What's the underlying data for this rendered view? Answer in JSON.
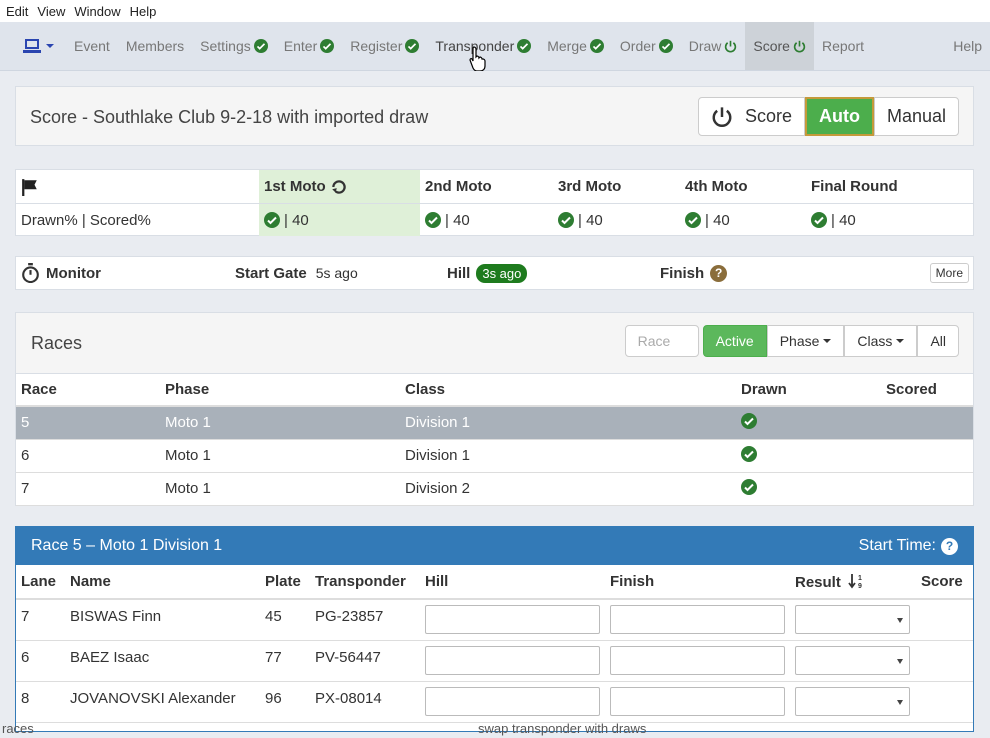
{
  "menu": [
    "Edit",
    "View",
    "Window",
    "Help"
  ],
  "nav": {
    "items": [
      {
        "label": "Event",
        "status": ""
      },
      {
        "label": "Members",
        "status": ""
      },
      {
        "label": "Settings",
        "status": "check"
      },
      {
        "label": "Enter",
        "status": "check"
      },
      {
        "label": "Register",
        "status": "check"
      },
      {
        "label": "Transponder",
        "status": "check"
      },
      {
        "label": "Merge",
        "status": "check"
      },
      {
        "label": "Order",
        "status": "check"
      },
      {
        "label": "Draw",
        "status": "power"
      },
      {
        "label": "Score",
        "status": "power",
        "active": true
      },
      {
        "label": "Report",
        "status": ""
      }
    ],
    "help": "Help"
  },
  "title_panel": {
    "title": "Score - Southlake Club 9-2-18 with imported draw",
    "score_label": "Score",
    "auto_label": "Auto",
    "manual_label": "Manual"
  },
  "moto_table": {
    "row_label": "Drawn% | Scored%",
    "columns": [
      {
        "name": "1st Moto",
        "value": "| 40"
      },
      {
        "name": "2nd Moto",
        "value": "| 40"
      },
      {
        "name": "3rd Moto",
        "value": "| 40"
      },
      {
        "name": "4th Moto",
        "value": "| 40"
      },
      {
        "name": "Final Round",
        "value": "| 40"
      }
    ]
  },
  "monitor": {
    "label": "Monitor",
    "start_gate_label": "Start Gate",
    "start_gate_value": "5s ago",
    "hill_label": "Hill",
    "hill_value": "3s ago",
    "finish_label": "Finish",
    "more_label": "More"
  },
  "races": {
    "title": "Races",
    "race_placeholder": "Race",
    "filters": {
      "active": "Active",
      "phase": "Phase",
      "class": "Class",
      "all": "All"
    },
    "headers": {
      "race": "Race",
      "phase": "Phase",
      "class": "Class",
      "drawn": "Drawn",
      "scored": "Scored"
    },
    "rows": [
      {
        "race": "5",
        "phase": "Moto 1",
        "class": "Division 1"
      },
      {
        "race": "6",
        "phase": "Moto 1",
        "class": "Division 1"
      },
      {
        "race": "7",
        "phase": "Moto 1",
        "class": "Division 2"
      }
    ]
  },
  "detail": {
    "title": "Race 5 – Moto 1 Division 1",
    "start_time_label": "Start Time:",
    "headers": {
      "lane": "Lane",
      "name": "Name",
      "plate": "Plate",
      "transponder": "Transponder",
      "hill": "Hill",
      "finish": "Finish",
      "result": "Result",
      "score": "Score"
    },
    "rows": [
      {
        "lane": "7",
        "name": "BISWAS Finn",
        "plate": "45",
        "transponder": "PG-23857"
      },
      {
        "lane": "6",
        "name": "BAEZ Isaac",
        "plate": "77",
        "transponder": "PV-56447"
      },
      {
        "lane": "8",
        "name": "JOVANOVSKI Alexander",
        "plate": "96",
        "transponder": "PX-08014"
      }
    ]
  },
  "footer": {
    "left": "races",
    "center": "swap transponder with draws"
  },
  "colors": {
    "green_check": "#2e7d32",
    "primary": "#337ab7",
    "active_green": "#5cb85c",
    "selected_row": "#a9b1ba"
  }
}
